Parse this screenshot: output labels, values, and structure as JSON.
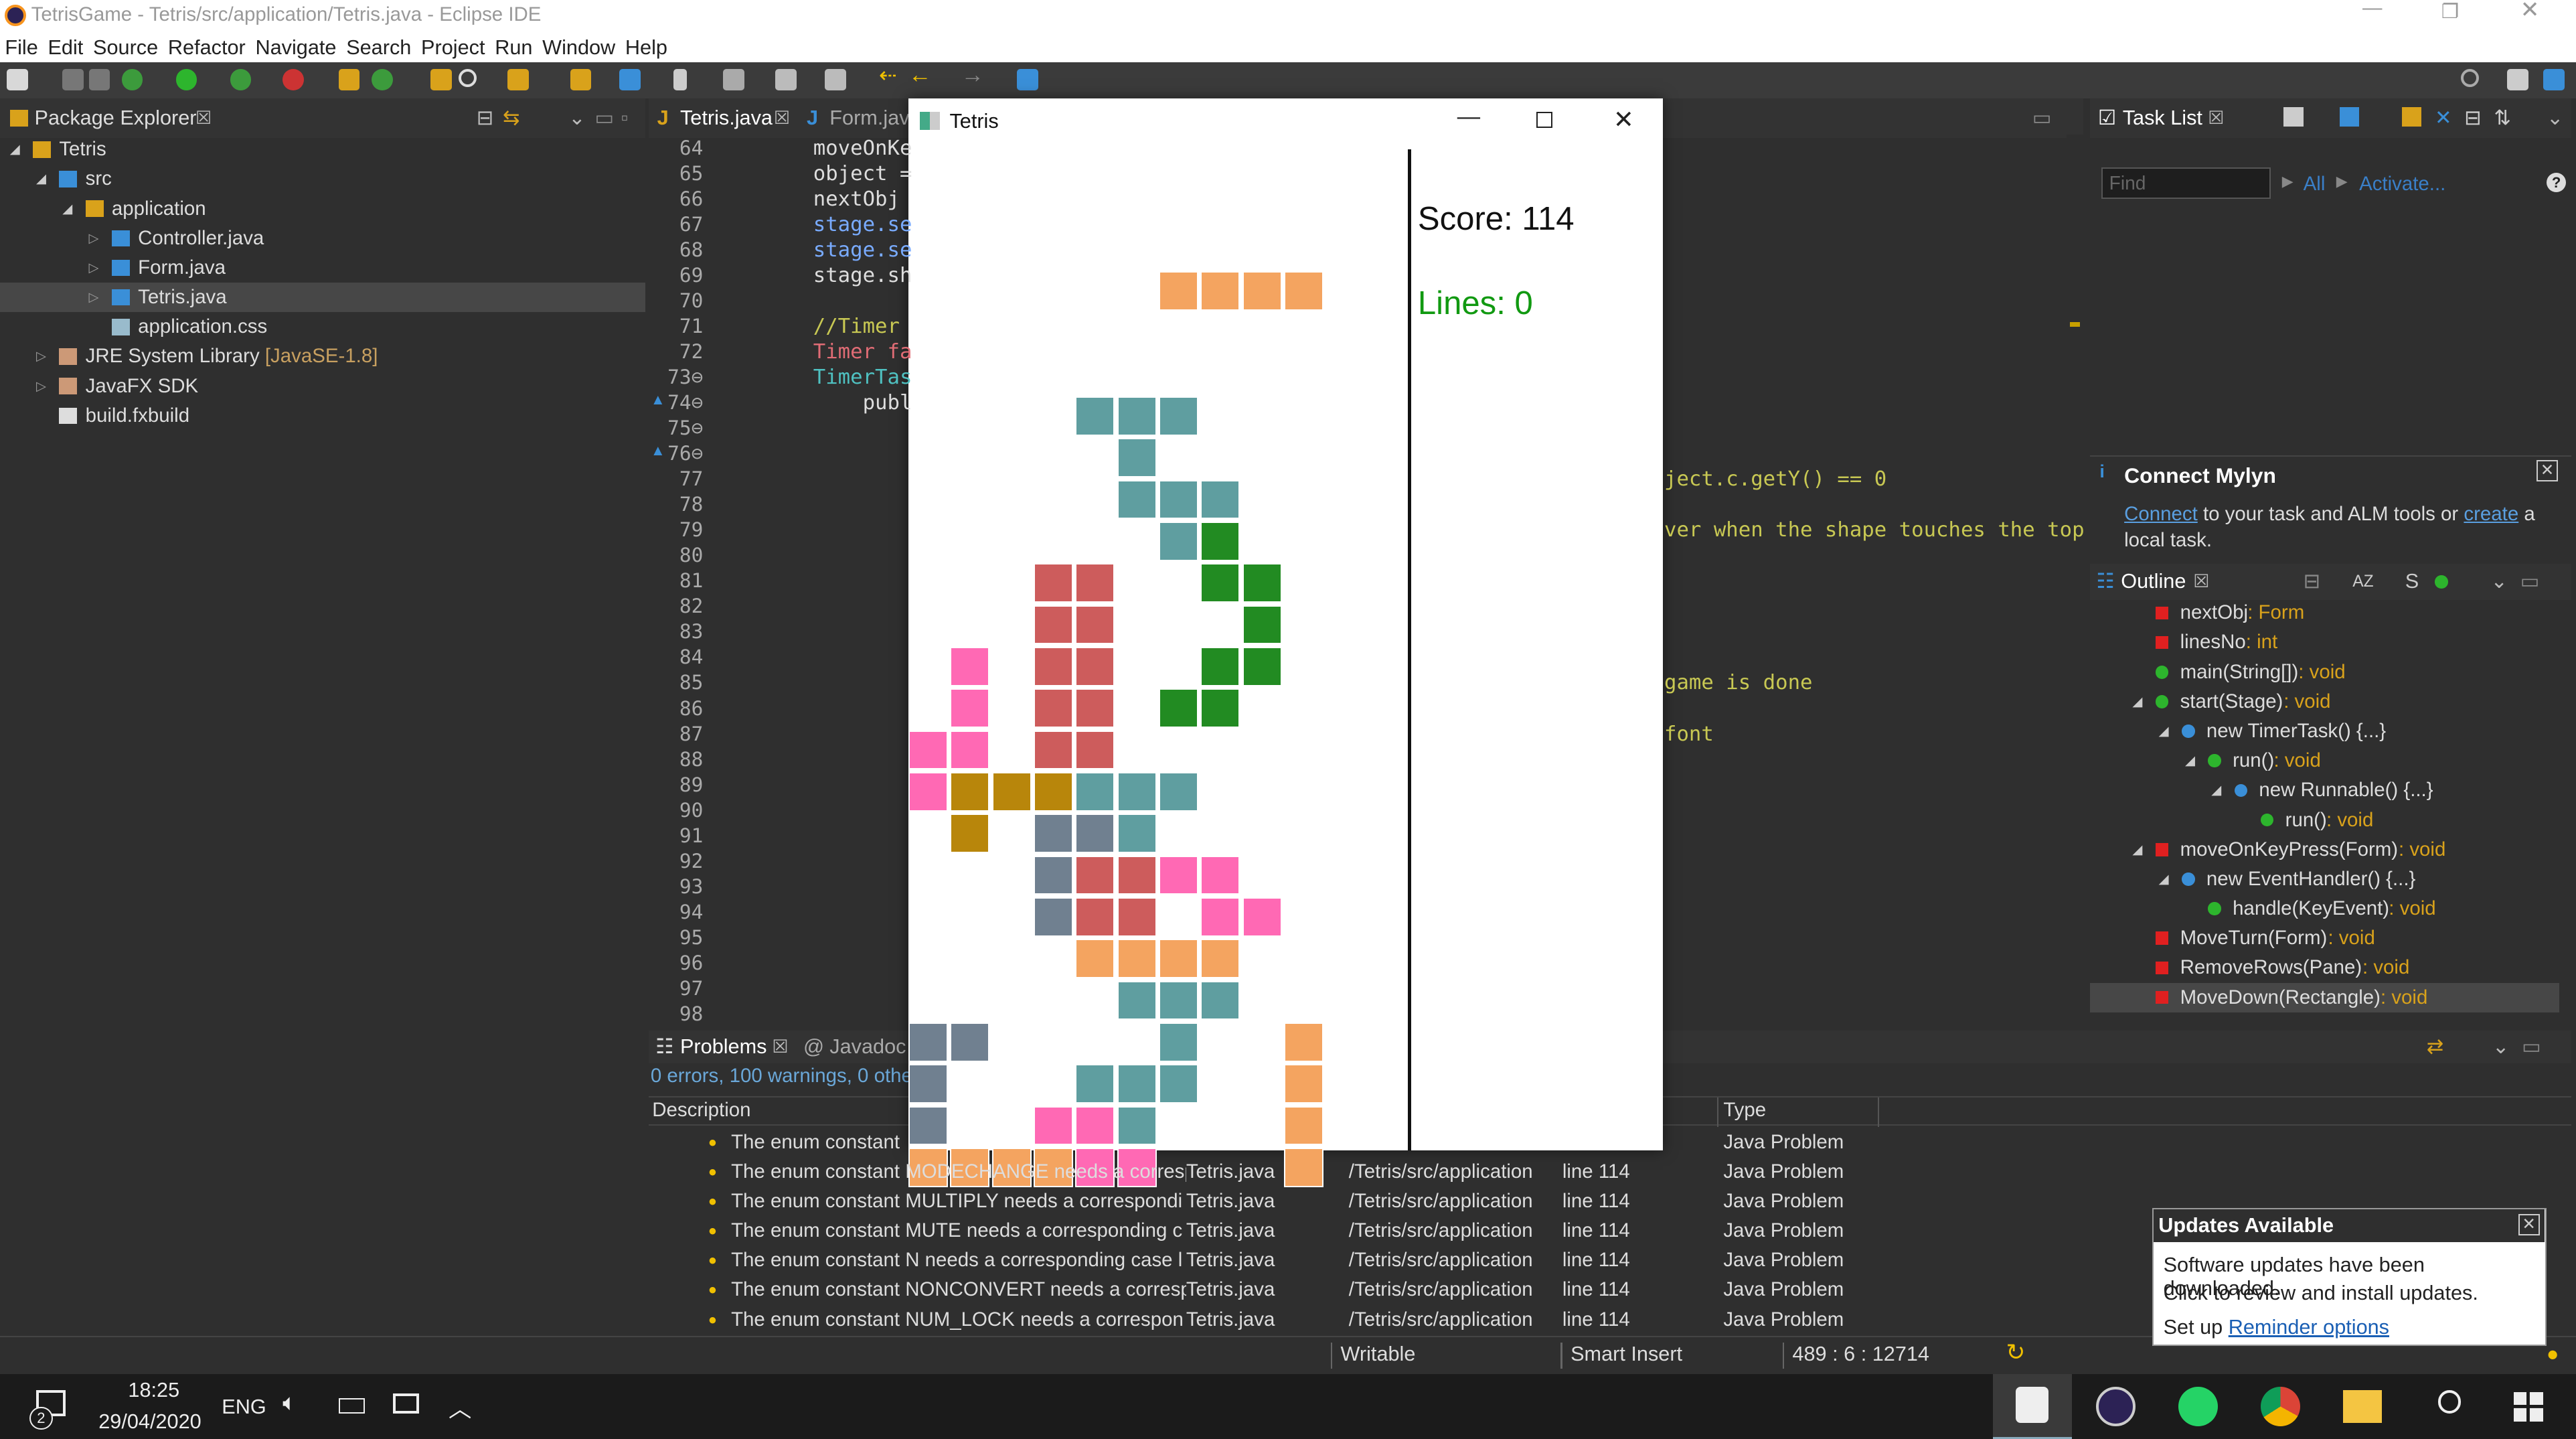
{
  "window": {
    "title": "TetrisGame - Tetris/src/application/Tetris.java - Eclipse IDE"
  },
  "menu": [
    "File",
    "Edit",
    "Source",
    "Refactor",
    "Navigate",
    "Search",
    "Project",
    "Run",
    "Window",
    "Help"
  ],
  "package_explorer": {
    "tab": "Package Explorer",
    "items": [
      {
        "label": "Tetris",
        "indent": 0,
        "icon": "project-icon"
      },
      {
        "label": "src",
        "indent": 1,
        "icon": "source-folder-icon"
      },
      {
        "label": "application",
        "indent": 2,
        "icon": "package-icon"
      },
      {
        "label": "Controller.java",
        "indent": 3,
        "icon": "java-file-icon"
      },
      {
        "label": "Form.java",
        "indent": 3,
        "icon": "java-file-icon"
      },
      {
        "label": "Tetris.java",
        "indent": 3,
        "icon": "java-file-icon",
        "selected": true
      },
      {
        "label": "application.css",
        "indent": 3,
        "icon": "css-file-icon"
      },
      {
        "label": "JRE System Library",
        "suffix": "[JavaSE-1.8]",
        "indent": 1,
        "icon": "library-icon"
      },
      {
        "label": "JavaFX SDK",
        "indent": 1,
        "icon": "library-icon"
      },
      {
        "label": "build.fxbuild",
        "indent": 1,
        "icon": "file-icon"
      }
    ]
  },
  "editor": {
    "tabs": [
      "Tetris.java",
      "Form.jav"
    ],
    "lines": [
      "64",
      "65",
      "66",
      "67",
      "68",
      "69",
      "70",
      "71",
      "72",
      "73⊖",
      "74⊖",
      "75⊖",
      "76⊖",
      "77",
      "78",
      "79",
      "80",
      "81",
      "82",
      "83",
      "84",
      "85",
      "86",
      "87",
      "88",
      "89",
      "90",
      "91",
      "92",
      "93",
      "94",
      "95",
      "96",
      "97",
      "98"
    ],
    "code_left": [
      {
        "line": "64",
        "text": "moveOnKe",
        "color": "#ddd"
      },
      {
        "line": "65",
        "text": "object =",
        "color": "#ddd"
      },
      {
        "line": "66",
        "text": "nextObj ",
        "color": "#ddd"
      },
      {
        "line": "67",
        "text": "stage.se",
        "color": "#79abff"
      },
      {
        "line": "68",
        "text": "stage.se",
        "color": "#79abff"
      },
      {
        "line": "69",
        "text": "stage.sh",
        "color": "#ddd"
      },
      {
        "line": "71",
        "text": "//Timer ",
        "color": "#c8c853"
      },
      {
        "line": "72",
        "text": "Timer fa",
        "color": "#e06c75"
      },
      {
        "line": "73",
        "text": "TimerTas",
        "color": "#4fc1c1"
      },
      {
        "line": "74",
        "text": "    publ",
        "color": "#ddd"
      }
    ],
    "code_right": [
      {
        "line": "77",
        "text": "ject.c.getY() == 0"
      },
      {
        "line": "79",
        "text": "ver when the shape touches the top"
      },
      {
        "line": "85",
        "text": "game is done"
      },
      {
        "line": "87",
        "text": "font"
      }
    ]
  },
  "tetris": {
    "title": "Tetris",
    "score": "Score: 114",
    "lines": "Lines: 0",
    "cells": [
      [
        "#f4a460",
        6,
        0
      ],
      [
        "#f4a460",
        7,
        0
      ],
      [
        "#f4a460",
        8,
        0
      ],
      [
        "#f4a460",
        9,
        0
      ],
      [
        "#5f9ea0",
        4,
        3
      ],
      [
        "#5f9ea0",
        5,
        3
      ],
      [
        "#5f9ea0",
        6,
        3
      ],
      [
        "#5f9ea0",
        5,
        4
      ],
      [
        "#5f9ea0",
        5,
        5
      ],
      [
        "#5f9ea0",
        6,
        5
      ],
      [
        "#5f9ea0",
        7,
        5
      ],
      [
        "#5f9ea0",
        6,
        6
      ],
      [
        "#228b22",
        7,
        6
      ],
      [
        "#cd5c5c",
        3,
        7
      ],
      [
        "#cd5c5c",
        4,
        7
      ],
      [
        "#228b22",
        7,
        7
      ],
      [
        "#228b22",
        8,
        7
      ],
      [
        "#cd5c5c",
        3,
        8
      ],
      [
        "#cd5c5c",
        4,
        8
      ],
      [
        "#228b22",
        8,
        8
      ],
      [
        "#cd5c5c",
        3,
        9
      ],
      [
        "#cd5c5c",
        4,
        9
      ],
      [
        "#ff69b4",
        1,
        9
      ],
      [
        "#228b22",
        7,
        9
      ],
      [
        "#228b22",
        8,
        9
      ],
      [
        "#cd5c5c",
        3,
        10
      ],
      [
        "#cd5c5c",
        4,
        10
      ],
      [
        "#ff69b4",
        1,
        10
      ],
      [
        "#228b22",
        6,
        10
      ],
      [
        "#228b22",
        7,
        10
      ],
      [
        "#ff69b4",
        0,
        11
      ],
      [
        "#ff69b4",
        1,
        11
      ],
      [
        "#cd5c5c",
        3,
        11
      ],
      [
        "#cd5c5c",
        4,
        11
      ],
      [
        "#ff69b4",
        0,
        12
      ],
      [
        "#b8860b",
        1,
        12
      ],
      [
        "#b8860b",
        2,
        12
      ],
      [
        "#b8860b",
        3,
        12
      ],
      [
        "#5f9ea0",
        4,
        12
      ],
      [
        "#5f9ea0",
        5,
        12
      ],
      [
        "#5f9ea0",
        6,
        12
      ],
      [
        "#b8860b",
        1,
        13
      ],
      [
        "#708090",
        3,
        13
      ],
      [
        "#708090",
        4,
        13
      ],
      [
        "#5f9ea0",
        5,
        13
      ],
      [
        "#708090",
        3,
        14
      ],
      [
        "#cd5c5c",
        4,
        14
      ],
      [
        "#cd5c5c",
        5,
        14
      ],
      [
        "#ff69b4",
        6,
        14
      ],
      [
        "#ff69b4",
        7,
        14
      ],
      [
        "#708090",
        3,
        15
      ],
      [
        "#cd5c5c",
        4,
        15
      ],
      [
        "#cd5c5c",
        5,
        15
      ],
      [
        "#ff69b4",
        7,
        15
      ],
      [
        "#ff69b4",
        8,
        15
      ],
      [
        "#f4a460",
        4,
        16
      ],
      [
        "#f4a460",
        5,
        16
      ],
      [
        "#f4a460",
        6,
        16
      ],
      [
        "#f4a460",
        7,
        16
      ],
      [
        "#5f9ea0",
        5,
        17
      ],
      [
        "#5f9ea0",
        6,
        17
      ],
      [
        "#5f9ea0",
        7,
        17
      ],
      [
        "#708090",
        0,
        18
      ],
      [
        "#708090",
        1,
        18
      ],
      [
        "#5f9ea0",
        6,
        18
      ],
      [
        "#f4a460",
        9,
        18
      ],
      [
        "#708090",
        0,
        19
      ],
      [
        "#5f9ea0",
        4,
        19
      ],
      [
        "#5f9ea0",
        5,
        19
      ],
      [
        "#5f9ea0",
        6,
        19
      ],
      [
        "#f4a460",
        9,
        19
      ],
      [
        "#708090",
        0,
        20
      ],
      [
        "#ff69b4",
        3,
        20
      ],
      [
        "#ff69b4",
        4,
        20
      ],
      [
        "#5f9ea0",
        5,
        20
      ],
      [
        "#f4a460",
        9,
        20
      ],
      [
        "#f4a460",
        0,
        21
      ],
      [
        "#f4a460",
        1,
        21
      ],
      [
        "#f4a460",
        2,
        21
      ],
      [
        "#f4a460",
        3,
        21
      ],
      [
        "#ff69b4",
        4,
        21
      ],
      [
        "#ff69b4",
        5,
        21
      ],
      [
        "#f4a460",
        9,
        21
      ]
    ]
  },
  "tasklist": {
    "tab": "Task List",
    "find_placeholder": "Find",
    "all": "All",
    "activate": "Activate..."
  },
  "mylyn": {
    "title": "Connect Mylyn",
    "connect": "Connect",
    "text1": " to your task and ALM tools or ",
    "create": "create",
    "text2": " a local task."
  },
  "outline": {
    "tab": "Outline",
    "items": [
      {
        "label": "nextObj",
        "type": " : Form",
        "indent": 0,
        "icon": "red"
      },
      {
        "label": "linesNo",
        "type": " : int",
        "indent": 0,
        "icon": "red"
      },
      {
        "label": "main(String[])",
        "type": " : void",
        "indent": 0,
        "icon": "green"
      },
      {
        "label": "start(Stage)",
        "type": " : void",
        "indent": 0,
        "icon": "green"
      },
      {
        "label": "new TimerTask() {...}",
        "type": "",
        "indent": 1,
        "icon": "class"
      },
      {
        "label": "run()",
        "type": " : void",
        "indent": 2,
        "icon": "green"
      },
      {
        "label": "new Runnable() {...}",
        "type": "",
        "indent": 3,
        "icon": "class"
      },
      {
        "label": "run()",
        "type": " : void",
        "indent": 4,
        "icon": "green"
      },
      {
        "label": "moveOnKeyPress(Form)",
        "type": " : void",
        "indent": 0,
        "icon": "red"
      },
      {
        "label": "new EventHandler() {...}",
        "type": "",
        "indent": 1,
        "icon": "class"
      },
      {
        "label": "handle(KeyEvent)",
        "type": " : void",
        "indent": 2,
        "icon": "green"
      },
      {
        "label": "MoveTurn(Form)",
        "type": " : void",
        "indent": 0,
        "icon": "red"
      },
      {
        "label": "RemoveRows(Pane)",
        "type": " : void",
        "indent": 0,
        "icon": "red"
      },
      {
        "label": "MoveDown(Rectangle)",
        "type": " : void",
        "indent": 0,
        "icon": "red",
        "selected": true
      }
    ]
  },
  "problems": {
    "tabs": [
      "Problems",
      "Javadoc"
    ],
    "summary": "0 errors, 100 warnings, 0 othe",
    "columns": [
      "Description",
      "Type"
    ],
    "rows": [
      {
        "desc": "The enum constant",
        "res": "",
        "path": "",
        "loc": "",
        "type": "Java Problem"
      },
      {
        "desc": "The enum constant MODECHANGE needs a corresp",
        "res": "Tetris.java",
        "path": "/Tetris/src/application",
        "loc": "line 114",
        "type": "Java Problem"
      },
      {
        "desc": "The enum constant MULTIPLY needs a correspondi",
        "res": "Tetris.java",
        "path": "/Tetris/src/application",
        "loc": "line 114",
        "type": "Java Problem"
      },
      {
        "desc": "The enum constant MUTE needs a corresponding c",
        "res": "Tetris.java",
        "path": "/Tetris/src/application",
        "loc": "line 114",
        "type": "Java Problem"
      },
      {
        "desc": "The enum constant N needs a corresponding case l",
        "res": "Tetris.java",
        "path": "/Tetris/src/application",
        "loc": "line 114",
        "type": "Java Problem"
      },
      {
        "desc": "The enum constant NONCONVERT needs a corresp",
        "res": "Tetris.java",
        "path": "/Tetris/src/application",
        "loc": "line 114",
        "type": "Java Problem"
      },
      {
        "desc": "The enum constant NUM_LOCK needs a correspon",
        "res": "Tetris.java",
        "path": "/Tetris/src/application",
        "loc": "line 114",
        "type": "Java Problem"
      }
    ]
  },
  "statusbar": {
    "writable": "Writable",
    "insert": "Smart Insert",
    "position": "489 : 6 : 12714"
  },
  "updates": {
    "title": "Updates Available",
    "line1": "Software updates have been downloaded.",
    "line2": "Click to review and install updates.",
    "setup": "Set up ",
    "reminder": "Reminder options"
  },
  "taskbar": {
    "time": "18:25",
    "date": "29/04/2020",
    "lang": "ENG",
    "notif_count": "2"
  }
}
